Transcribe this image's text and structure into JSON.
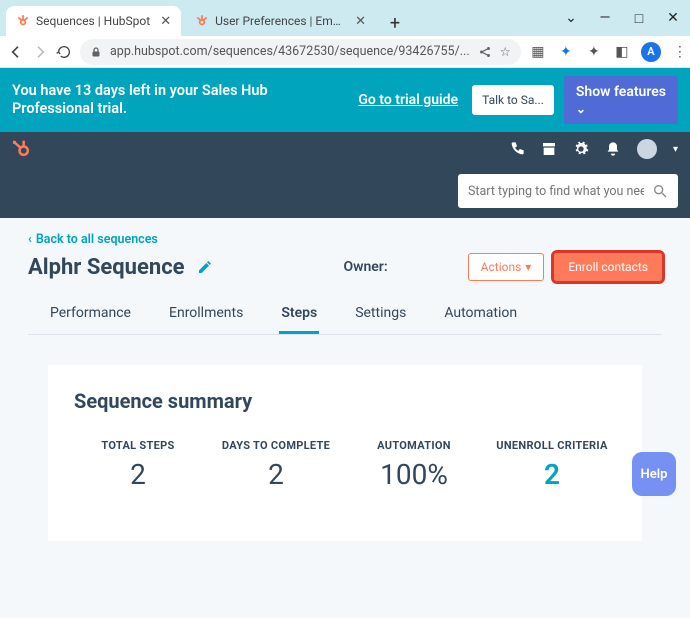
{
  "browser": {
    "tabs": [
      {
        "title": "Sequences | HubSpot",
        "active": true
      },
      {
        "title": "User Preferences | Email",
        "active": false
      }
    ],
    "url_display": "app.hubspot.com/sequences/43672530/sequence/93426755/...",
    "avatar_letter": "A"
  },
  "trial": {
    "message": "You have 13 days left in your Sales Hub Professional trial.",
    "guide_link": "Go to trial guide",
    "talk_button": "Talk to Sa...",
    "show_features": "Show features"
  },
  "search": {
    "placeholder": "Start typing to find what you need"
  },
  "page": {
    "back_link": "Back to all sequences",
    "title": "Alphr Sequence",
    "owner_label": "Owner:",
    "actions_btn": "Actions",
    "enroll_btn": "Enroll contacts",
    "tabs": [
      "Performance",
      "Enrollments",
      "Steps",
      "Settings",
      "Automation"
    ],
    "active_tab_index": 2,
    "summary_title": "Sequence summary",
    "stats": [
      {
        "label": "TOTAL STEPS",
        "value": "2"
      },
      {
        "label": "DAYS TO COMPLETE",
        "value": "2"
      },
      {
        "label": "AUTOMATION",
        "value": "100%"
      },
      {
        "label": "UNENROLL CRITERIA",
        "value": "2"
      }
    ]
  },
  "help": "Help"
}
